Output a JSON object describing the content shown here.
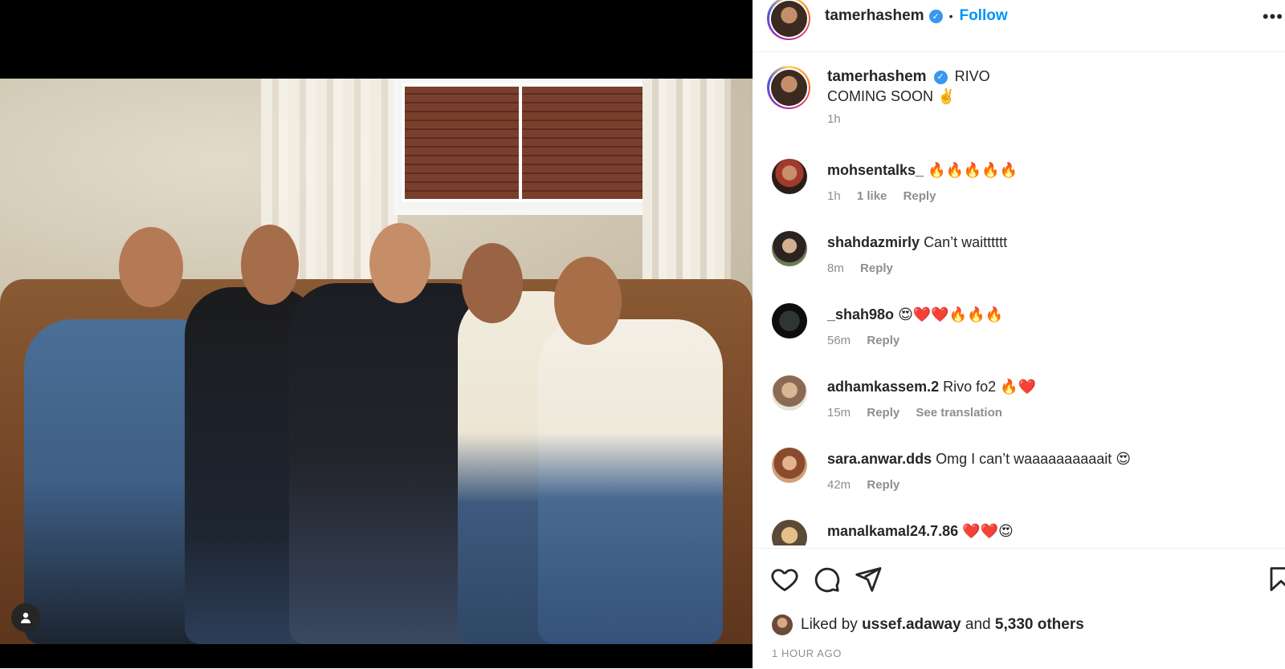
{
  "post": {
    "author": "tamerhashem",
    "follow_label": "Follow",
    "separator": "•",
    "more_label": "•••"
  },
  "caption": {
    "username": "tamerhashem",
    "line1": "RIVO",
    "line2": "COMING SOON ✌️",
    "time": "1h"
  },
  "comments": [
    {
      "username": "mohsentalks_",
      "text": "🔥🔥🔥🔥🔥",
      "time": "1h",
      "likes": "1 like",
      "reply": "Reply",
      "translate": ""
    },
    {
      "username": "shahdazmirly",
      "text": "Can’t waitttttt",
      "time": "8m",
      "likes": "",
      "reply": "Reply",
      "translate": ""
    },
    {
      "username": "_shah98o",
      "text": "😍❤️❤️🔥🔥🔥",
      "time": "56m",
      "likes": "",
      "reply": "Reply",
      "translate": ""
    },
    {
      "username": "adhamkassem.2",
      "text": "Rivo fo2 🔥❤️",
      "time": "15m",
      "likes": "",
      "reply": "Reply",
      "translate": "See translation"
    },
    {
      "username": "sara.anwar.dds",
      "text": "Omg I can’t waaaaaaaaaait 😍",
      "time": "42m",
      "likes": "",
      "reply": "Reply",
      "translate": ""
    },
    {
      "username": "manalkamal24.7.86",
      "text": "❤️❤️😍",
      "time": "",
      "likes": "",
      "reply": "",
      "translate": ""
    }
  ],
  "likes": {
    "prefix": "Liked by",
    "user": "ussef.adaway",
    "joiner": "and",
    "others": "5,330 others"
  },
  "posted_ago": "1 HOUR AGO",
  "icons": {
    "like": "heart-icon",
    "comment": "comment-icon",
    "share": "share-icon",
    "save": "bookmark-icon",
    "profile_tag": "user-tag-icon"
  },
  "colors": {
    "accent": "#0095f6",
    "verified": "#3897f0",
    "muted": "#8e8e8e",
    "text": "#262626"
  }
}
